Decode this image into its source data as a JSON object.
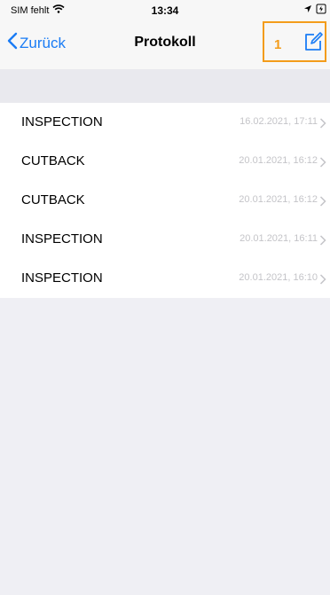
{
  "status_bar": {
    "carrier": "SIM fehlt",
    "time": "13:34"
  },
  "nav": {
    "back_label": "Zurück",
    "title": "Protokoll",
    "highlight_number": "1"
  },
  "protocol_list": {
    "items": [
      {
        "label": "INSPECTION",
        "date": "16.02.2021, 17:11"
      },
      {
        "label": "CUTBACK",
        "date": "20.01.2021, 16:12"
      },
      {
        "label": "CUTBACK",
        "date": "20.01.2021, 16:12"
      },
      {
        "label": "INSPECTION",
        "date": "20.01.2021, 16:11"
      },
      {
        "label": "INSPECTION",
        "date": "20.01.2021, 16:10"
      }
    ]
  },
  "colors": {
    "accent": "#1a7cf5",
    "highlight": "#f39c1a",
    "date_text": "#c4c4c8",
    "background": "#efeff4"
  },
  "icons": [
    "wifi-icon",
    "location-arrow-icon",
    "battery-icon",
    "chevron-left-icon",
    "compose-icon",
    "chevron-right-icon"
  ]
}
